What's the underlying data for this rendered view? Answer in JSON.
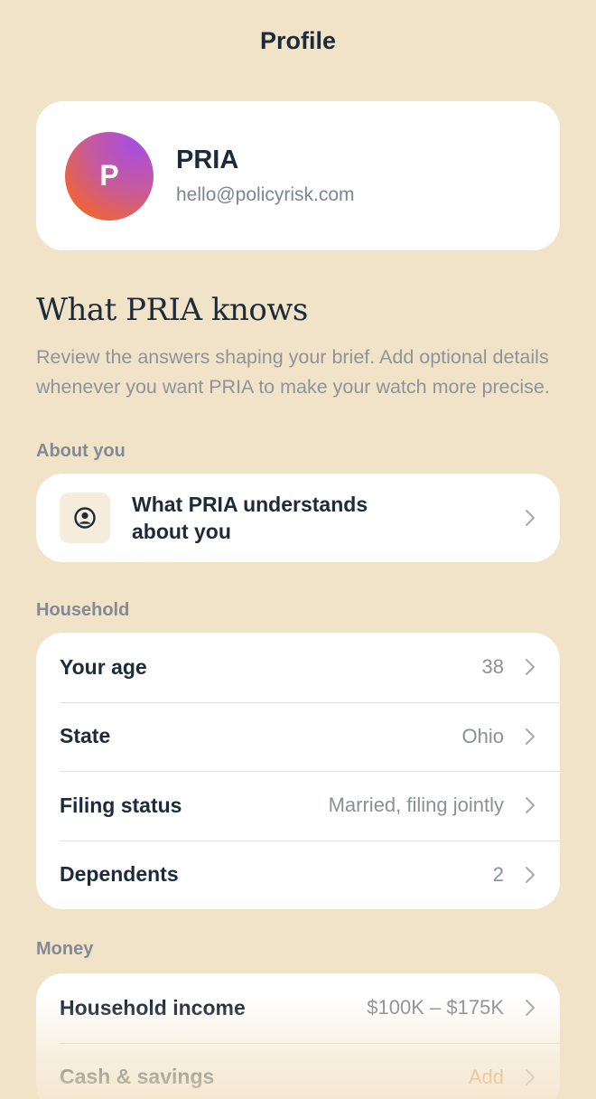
{
  "header": {
    "title": "Profile"
  },
  "profile": {
    "initial": "P",
    "name": "PRIA",
    "email": "hello@policyrisk.com"
  },
  "knows": {
    "heading": "What PRIA knows",
    "description": "Review the answers shaping your brief. Add optional details whenever you want PRIA to make your watch more precise."
  },
  "about": {
    "label": "About you",
    "item": {
      "icon": "user-circle-icon",
      "line1": "What PRIA understands",
      "line2": "about you"
    }
  },
  "household": {
    "label": "Household",
    "rows": [
      {
        "label": "Your age",
        "value": "38"
      },
      {
        "label": "State",
        "value": "Ohio"
      },
      {
        "label": "Filing status",
        "value": "Married, filing jointly"
      },
      {
        "label": "Dependents",
        "value": "2"
      }
    ]
  },
  "money": {
    "label": "Money",
    "rows": [
      {
        "label": "Household income",
        "value": "$100K – $175K"
      },
      {
        "label": "Cash & savings",
        "value": "Add"
      }
    ]
  },
  "colors": {
    "background": "#f1e3c8",
    "card": "#ffffff",
    "text": "#1c2a3a",
    "muted": "#8b8f96",
    "accent": "#e8843e"
  }
}
